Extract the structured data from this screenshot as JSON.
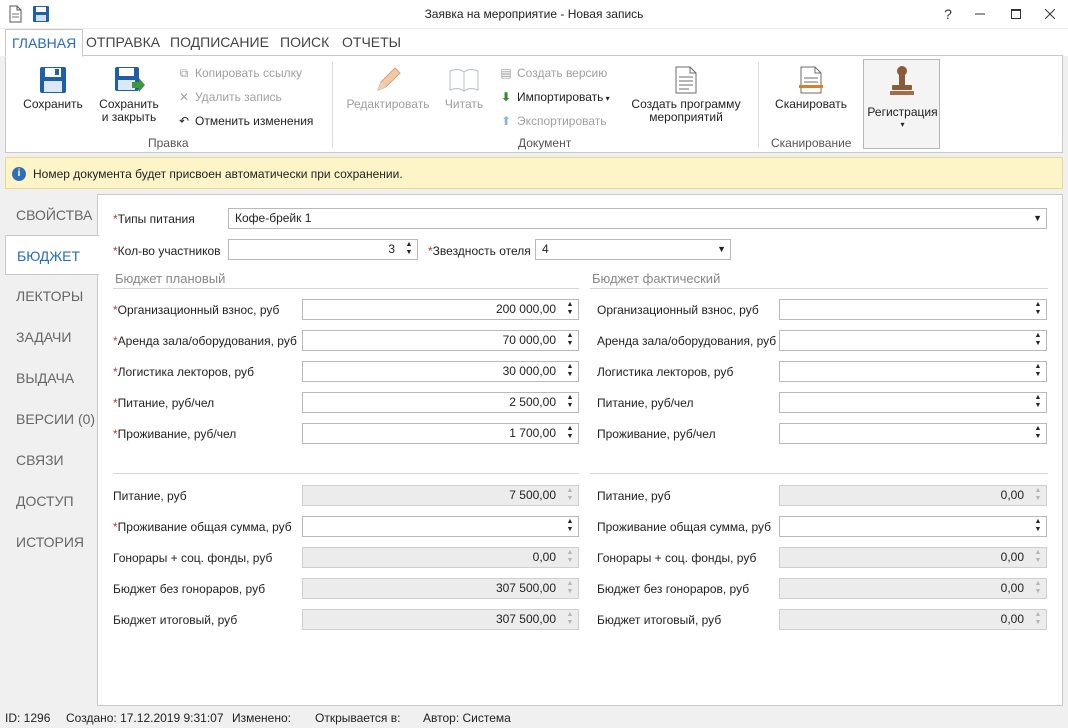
{
  "window": {
    "title": "Заявка на мероприятие - Новая запись",
    "help": "?"
  },
  "tabs": [
    "ГЛАВНАЯ",
    "ОТПРАВКА",
    "ПОДПИСАНИЕ",
    "ПОИСК",
    "ОТЧЕТЫ"
  ],
  "ribbon": {
    "save": "Сохранить",
    "save_close_1": "Сохранить",
    "save_close_2": "и закрыть",
    "copy_link": "Копировать ссылку",
    "delete": "Удалить запись",
    "undo": "Отменить изменения",
    "group_edit": "Правка",
    "edit": "Редактировать",
    "read": "Читать",
    "create_version": "Создать версию",
    "import": "Импортировать",
    "export": "Экспортировать",
    "create_program_1": "Создать программу",
    "create_program_2": "мероприятий",
    "group_document": "Документ",
    "scan": "Сканировать",
    "group_scan": "Сканирование",
    "register": "Регистрация"
  },
  "info": "Номер документа будет присвоен автоматически при сохранении.",
  "nav": [
    "СВОЙСТВА",
    "БЮДЖЕТ",
    "ЛЕКТОРЫ",
    "ЗАДАЧИ",
    "ВЫДАЧА",
    "ВЕРСИИ (0)",
    "СВЯЗИ",
    "ДОСТУП",
    "ИСТОРИЯ"
  ],
  "form": {
    "meal_label": "Типы питания",
    "meal_value": "Кофе-брейк 1",
    "participants_label": "Кол-во участников",
    "participants_value": "3",
    "stars_label": "Звездность отеля",
    "stars_value": "4",
    "planned_title": "Бюджет плановый",
    "actual_title": "Бюджет фактический",
    "rows1": [
      {
        "label": "Организационный взнос, руб",
        "plan": "200 000,00",
        "fact": ""
      },
      {
        "label": "Аренда зала/оборудования, руб",
        "plan": "70 000,00",
        "fact": ""
      },
      {
        "label": "Логистика лекторов, руб",
        "plan": "30 000,00",
        "fact": ""
      },
      {
        "label": "Питание, руб/чел",
        "plan": "2 500,00",
        "fact": ""
      },
      {
        "label": "Проживание, руб/чел",
        "plan": "1 700,00",
        "fact": ""
      }
    ],
    "rows2": [
      {
        "label": "Питание, руб",
        "plan": "7 500,00",
        "fact": "0,00"
      },
      {
        "label": "Проживание общая сумма, руб",
        "plan": "",
        "fact": ""
      },
      {
        "label": "Гонорары + соц. фонды, руб",
        "plan": "0,00",
        "fact": "0,00"
      },
      {
        "label": "Бюджет без гонораров, руб",
        "plan": "307 500,00",
        "fact": "0,00"
      },
      {
        "label": "Бюджет итоговый, руб",
        "plan": "307 500,00",
        "fact": "0,00"
      }
    ]
  },
  "status": {
    "id": "ID: 1296",
    "created": "Создано: 17.12.2019 9:31:07",
    "changed": "Изменено:",
    "opened": "Открывается в:",
    "author": "Автор: Система"
  },
  "colors": {
    "accent": "#2a6bb6",
    "info_bg": "#fdf5c8",
    "required": "#c0392b"
  }
}
